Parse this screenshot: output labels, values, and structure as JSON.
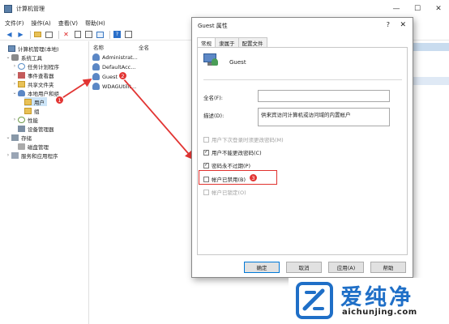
{
  "window": {
    "title": "计算机管理",
    "minimize_glyph": "—",
    "maximize_glyph": "☐",
    "close_glyph": "✕"
  },
  "menu": [
    "文件(F)",
    "操作(A)",
    "查看(V)",
    "帮助(H)"
  ],
  "tree": {
    "root": "计算机管理(本地)",
    "system_tools": "系统工具",
    "task_scheduler": "任务计划程序",
    "event_viewer": "事件查看器",
    "shared_folders": "共享文件夹",
    "local_users_groups": "本地用户和组",
    "users": "用户",
    "groups": "组",
    "performance": "性能",
    "device_manager": "设备管理器",
    "storage": "存储",
    "disk_management": "磁盘管理",
    "services_apps": "服务和应用程序"
  },
  "list": {
    "col_name": "名称",
    "col_fullname": "全名",
    "rows": [
      "Administrat...",
      "DefaultAcc...",
      "Guest",
      "WDAGUtilit..."
    ]
  },
  "dialog": {
    "title": "Guest 属性",
    "help_glyph": "?",
    "close_glyph": "✕",
    "tabs": [
      "常规",
      "隶属于",
      "配置文件"
    ],
    "user_name": "Guest",
    "fullname_label": "全名(F):",
    "fullname_value": "",
    "desc_label": "描述(D):",
    "desc_value": "供来宾访问计算机或访问域的内置帐户",
    "checkboxes": [
      {
        "label": "用户下次登录时须更改密码(M)",
        "checked": false,
        "disabled": true
      },
      {
        "label": "用户不能更改密码(C)",
        "checked": true,
        "disabled": false
      },
      {
        "label": "密码永不过期(P)",
        "checked": true,
        "disabled": false
      },
      {
        "label": "帐户已禁用(B)",
        "checked": false,
        "disabled": false
      },
      {
        "label": "帐户已锁定(O)",
        "checked": false,
        "disabled": true
      }
    ],
    "check_glyph": "✓",
    "buttons": [
      "确定",
      "取消",
      "应用(A)",
      "帮助"
    ]
  },
  "annotations": [
    "1",
    "2",
    "3"
  ],
  "watermark": {
    "chinese": "爱纯净",
    "url": "aichunjing.com"
  },
  "colors": {
    "annotation_red": "#e23533",
    "selection_blue": "#cce4f7",
    "watermark_blue": "#1f6fc7"
  }
}
